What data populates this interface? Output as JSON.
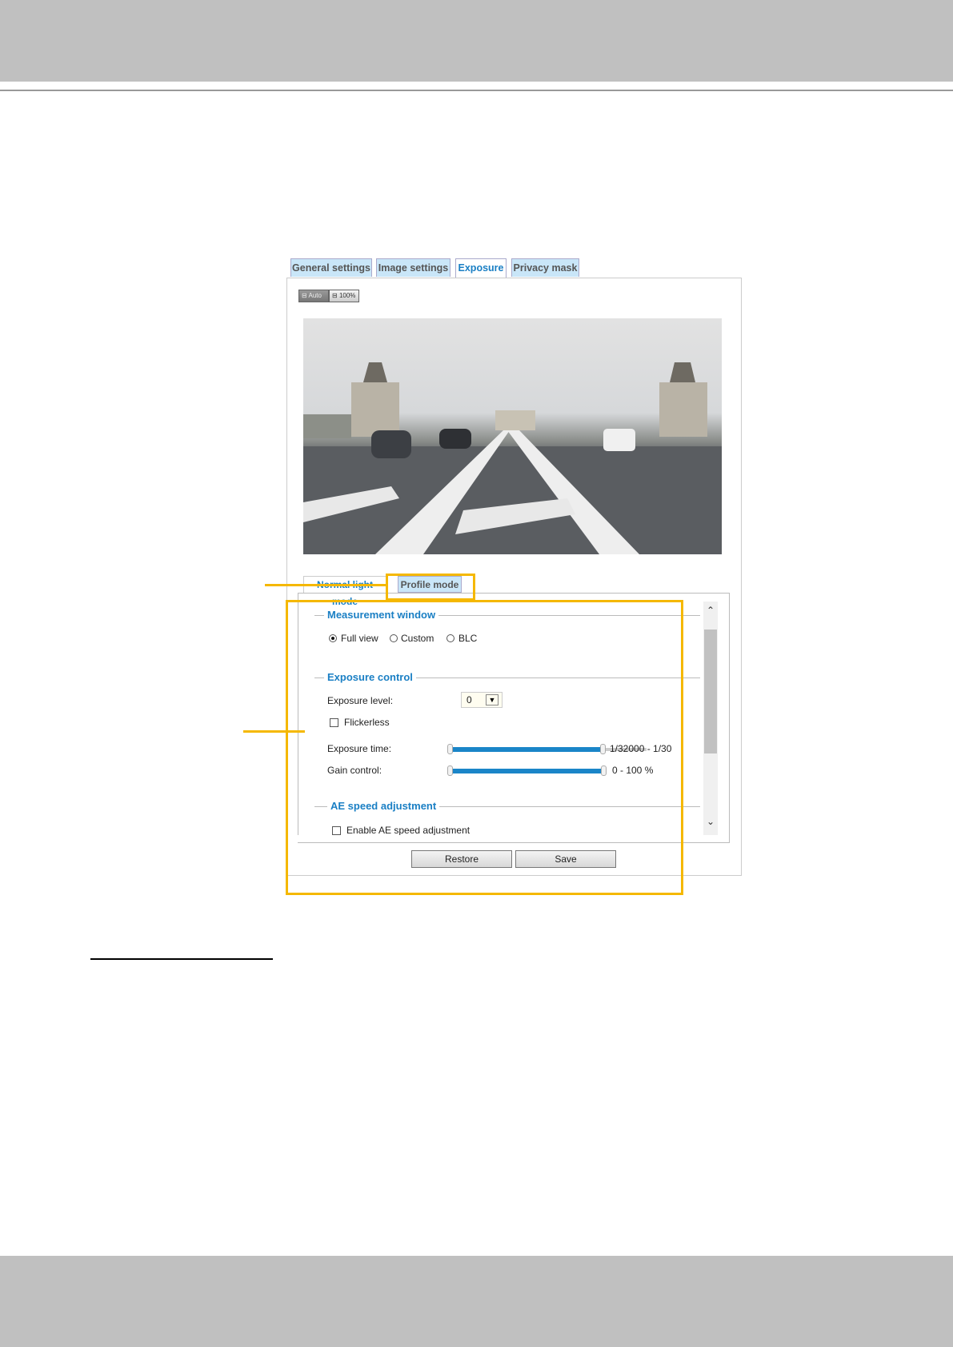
{
  "tabs": [
    {
      "label": "General settings"
    },
    {
      "label": "Image settings"
    },
    {
      "label": "Exposure",
      "active": true
    },
    {
      "label": "Privacy mask"
    }
  ],
  "view_buttons": {
    "auto": "Auto",
    "full": "100%"
  },
  "subtabs": [
    {
      "label": "Normal light mode"
    },
    {
      "label": "Profile mode",
      "active": true
    }
  ],
  "measurement": {
    "title": "Measurement window",
    "options": [
      "Full view",
      "Custom",
      "BLC"
    ],
    "selected": "Full view"
  },
  "exposure": {
    "title": "Exposure control",
    "level_label": "Exposure level:",
    "level_value": "0",
    "flickerless": "Flickerless",
    "flickerless_checked": false,
    "time_label": "Exposure time:",
    "time_value": "1/32000 - 1/30",
    "time_fill_percent": 78,
    "gain_label": "Gain control:",
    "gain_value": "0 - 100 %",
    "gain_fill_percent": 100
  },
  "ae": {
    "title": "AE speed adjustment",
    "enable_label": "Enable AE speed adjustment",
    "enable_checked": false
  },
  "buttons": {
    "restore": "Restore",
    "save": "Save"
  },
  "colors": {
    "accent": "#1a7fc4",
    "highlight": "#f5b800",
    "tab_bg": "#c9e6f8",
    "slider": "#1a85c8"
  }
}
